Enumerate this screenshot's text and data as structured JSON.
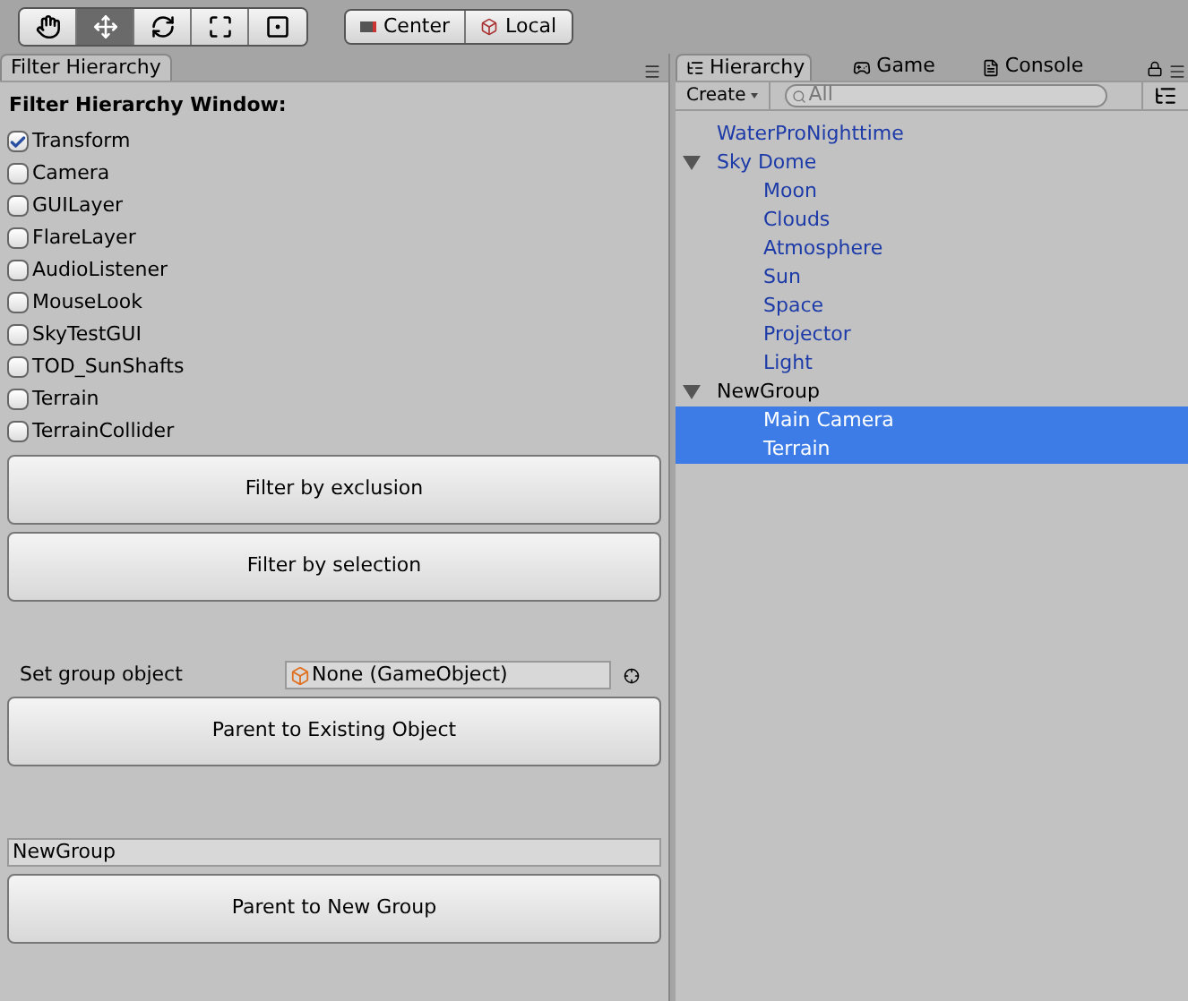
{
  "toolbar": {
    "tools": [
      {
        "kind": "hand",
        "selected": false
      },
      {
        "kind": "move",
        "selected": true
      },
      {
        "kind": "rotate",
        "selected": false
      },
      {
        "kind": "scale",
        "selected": false
      },
      {
        "kind": "rect",
        "selected": false
      }
    ],
    "pivot": [
      {
        "kind": "pivot",
        "label": "Center"
      },
      {
        "kind": "space",
        "label": "Local"
      }
    ]
  },
  "filter_panel": {
    "tab": "Filter Hierarchy",
    "heading": "Filter Hierarchy Window:",
    "components": [
      {
        "label": "Transform",
        "checked": true
      },
      {
        "label": "Camera",
        "checked": false
      },
      {
        "label": "GUILayer",
        "checked": false
      },
      {
        "label": "FlareLayer",
        "checked": false
      },
      {
        "label": "AudioListener",
        "checked": false
      },
      {
        "label": "MouseLook",
        "checked": false
      },
      {
        "label": "SkyTestGUI",
        "checked": false
      },
      {
        "label": "TOD_SunShafts",
        "checked": false
      },
      {
        "label": "Terrain",
        "checked": false
      },
      {
        "label": "TerrainCollider",
        "checked": false
      }
    ],
    "filter_buttons": [
      "Filter by exclusion",
      "Filter by selection"
    ],
    "group_object": {
      "label": "Set group object",
      "value": "None (GameObject)"
    },
    "parent_existing_button": "Parent to Existing Object",
    "group_name": {
      "value": "NewGroup"
    },
    "parent_new_button": "Parent to New Group"
  },
  "hierarchy_panel": {
    "tabs": [
      {
        "kind": "hierarchy",
        "label": "Hierarchy",
        "selected": true
      },
      {
        "kind": "game",
        "label": "Game",
        "selected": false
      },
      {
        "kind": "console",
        "label": "Console",
        "selected": false
      }
    ],
    "create_button": "Create",
    "search": {
      "placeholder": "All"
    },
    "tree": [
      {
        "name": "WaterProNighttime",
        "prefab": true,
        "selected": false
      },
      {
        "name": "Sky Dome",
        "prefab": true,
        "selected": false,
        "expanded": true,
        "children": [
          {
            "name": "Moon",
            "prefab": true,
            "selected": false
          },
          {
            "name": "Clouds",
            "prefab": true,
            "selected": false
          },
          {
            "name": "Atmosphere",
            "prefab": true,
            "selected": false
          },
          {
            "name": "Sun",
            "prefab": true,
            "selected": false
          },
          {
            "name": "Space",
            "prefab": true,
            "selected": false
          },
          {
            "name": "Projector",
            "prefab": true,
            "selected": false
          },
          {
            "name": "Light",
            "prefab": true,
            "selected": false
          }
        ]
      },
      {
        "name": "NewGroup",
        "prefab": false,
        "selected": false,
        "expanded": true,
        "children": [
          {
            "name": "Main Camera",
            "prefab": false,
            "selected": true
          },
          {
            "name": "Terrain",
            "prefab": false,
            "selected": true
          }
        ]
      }
    ]
  }
}
